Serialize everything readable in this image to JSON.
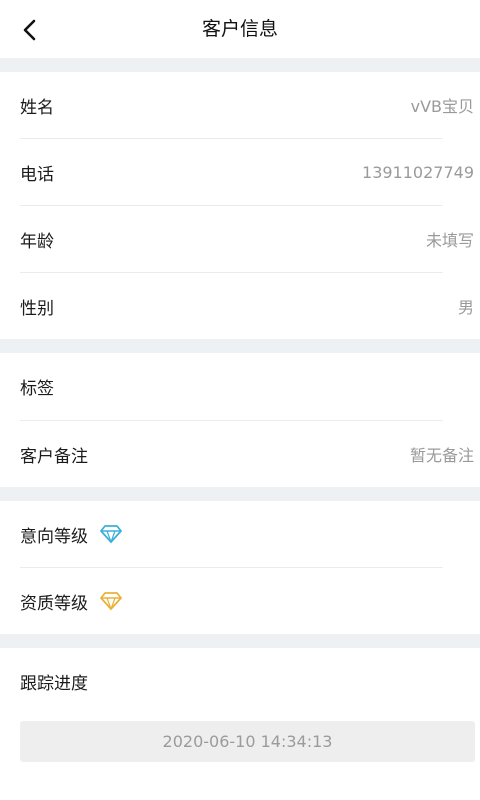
{
  "header": {
    "title": "客户信息"
  },
  "basic": {
    "name": {
      "label": "姓名",
      "value": "vVB宝贝"
    },
    "phone": {
      "label": "电话",
      "value": "13911027749"
    },
    "age": {
      "label": "年龄",
      "value": "未填写"
    },
    "gender": {
      "label": "性别",
      "value": "男"
    }
  },
  "notes": {
    "tags": {
      "label": "标签",
      "value": ""
    },
    "remark": {
      "label": "客户备注",
      "value": "暂无备注"
    }
  },
  "levels": {
    "intent": {
      "label": "意向等级",
      "icon": "diamond-icon",
      "color": "#3bb0d8"
    },
    "quality": {
      "label": "资质等级",
      "icon": "diamond-icon",
      "color": "#e8b23a"
    }
  },
  "progress": {
    "label": "跟踪进度",
    "time": "2020-06-10 14:34:13"
  }
}
